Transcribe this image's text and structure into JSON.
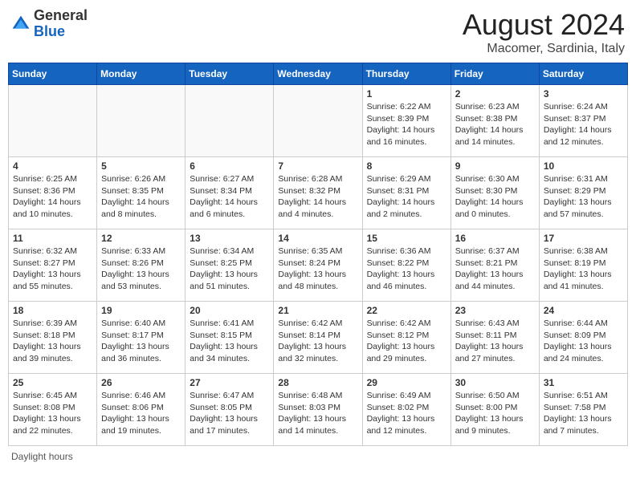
{
  "header": {
    "logo_general": "General",
    "logo_blue": "Blue",
    "title": "August 2024",
    "subtitle": "Macomer, Sardinia, Italy"
  },
  "days_of_week": [
    "Sunday",
    "Monday",
    "Tuesday",
    "Wednesday",
    "Thursday",
    "Friday",
    "Saturday"
  ],
  "footer": {
    "label": "Daylight hours"
  },
  "weeks": [
    [
      {
        "day": "",
        "sunrise": "",
        "sunset": "",
        "daylight": "",
        "empty": true
      },
      {
        "day": "",
        "sunrise": "",
        "sunset": "",
        "daylight": "",
        "empty": true
      },
      {
        "day": "",
        "sunrise": "",
        "sunset": "",
        "daylight": "",
        "empty": true
      },
      {
        "day": "",
        "sunrise": "",
        "sunset": "",
        "daylight": "",
        "empty": true
      },
      {
        "day": "1",
        "sunrise": "Sunrise: 6:22 AM",
        "sunset": "Sunset: 8:39 PM",
        "daylight": "Daylight: 14 hours and 16 minutes."
      },
      {
        "day": "2",
        "sunrise": "Sunrise: 6:23 AM",
        "sunset": "Sunset: 8:38 PM",
        "daylight": "Daylight: 14 hours and 14 minutes."
      },
      {
        "day": "3",
        "sunrise": "Sunrise: 6:24 AM",
        "sunset": "Sunset: 8:37 PM",
        "daylight": "Daylight: 14 hours and 12 minutes."
      }
    ],
    [
      {
        "day": "4",
        "sunrise": "Sunrise: 6:25 AM",
        "sunset": "Sunset: 8:36 PM",
        "daylight": "Daylight: 14 hours and 10 minutes."
      },
      {
        "day": "5",
        "sunrise": "Sunrise: 6:26 AM",
        "sunset": "Sunset: 8:35 PM",
        "daylight": "Daylight: 14 hours and 8 minutes."
      },
      {
        "day": "6",
        "sunrise": "Sunrise: 6:27 AM",
        "sunset": "Sunset: 8:34 PM",
        "daylight": "Daylight: 14 hours and 6 minutes."
      },
      {
        "day": "7",
        "sunrise": "Sunrise: 6:28 AM",
        "sunset": "Sunset: 8:32 PM",
        "daylight": "Daylight: 14 hours and 4 minutes."
      },
      {
        "day": "8",
        "sunrise": "Sunrise: 6:29 AM",
        "sunset": "Sunset: 8:31 PM",
        "daylight": "Daylight: 14 hours and 2 minutes."
      },
      {
        "day": "9",
        "sunrise": "Sunrise: 6:30 AM",
        "sunset": "Sunset: 8:30 PM",
        "daylight": "Daylight: 14 hours and 0 minutes."
      },
      {
        "day": "10",
        "sunrise": "Sunrise: 6:31 AM",
        "sunset": "Sunset: 8:29 PM",
        "daylight": "Daylight: 13 hours and 57 minutes."
      }
    ],
    [
      {
        "day": "11",
        "sunrise": "Sunrise: 6:32 AM",
        "sunset": "Sunset: 8:27 PM",
        "daylight": "Daylight: 13 hours and 55 minutes."
      },
      {
        "day": "12",
        "sunrise": "Sunrise: 6:33 AM",
        "sunset": "Sunset: 8:26 PM",
        "daylight": "Daylight: 13 hours and 53 minutes."
      },
      {
        "day": "13",
        "sunrise": "Sunrise: 6:34 AM",
        "sunset": "Sunset: 8:25 PM",
        "daylight": "Daylight: 13 hours and 51 minutes."
      },
      {
        "day": "14",
        "sunrise": "Sunrise: 6:35 AM",
        "sunset": "Sunset: 8:24 PM",
        "daylight": "Daylight: 13 hours and 48 minutes."
      },
      {
        "day": "15",
        "sunrise": "Sunrise: 6:36 AM",
        "sunset": "Sunset: 8:22 PM",
        "daylight": "Daylight: 13 hours and 46 minutes."
      },
      {
        "day": "16",
        "sunrise": "Sunrise: 6:37 AM",
        "sunset": "Sunset: 8:21 PM",
        "daylight": "Daylight: 13 hours and 44 minutes."
      },
      {
        "day": "17",
        "sunrise": "Sunrise: 6:38 AM",
        "sunset": "Sunset: 8:19 PM",
        "daylight": "Daylight: 13 hours and 41 minutes."
      }
    ],
    [
      {
        "day": "18",
        "sunrise": "Sunrise: 6:39 AM",
        "sunset": "Sunset: 8:18 PM",
        "daylight": "Daylight: 13 hours and 39 minutes."
      },
      {
        "day": "19",
        "sunrise": "Sunrise: 6:40 AM",
        "sunset": "Sunset: 8:17 PM",
        "daylight": "Daylight: 13 hours and 36 minutes."
      },
      {
        "day": "20",
        "sunrise": "Sunrise: 6:41 AM",
        "sunset": "Sunset: 8:15 PM",
        "daylight": "Daylight: 13 hours and 34 minutes."
      },
      {
        "day": "21",
        "sunrise": "Sunrise: 6:42 AM",
        "sunset": "Sunset: 8:14 PM",
        "daylight": "Daylight: 13 hours and 32 minutes."
      },
      {
        "day": "22",
        "sunrise": "Sunrise: 6:42 AM",
        "sunset": "Sunset: 8:12 PM",
        "daylight": "Daylight: 13 hours and 29 minutes."
      },
      {
        "day": "23",
        "sunrise": "Sunrise: 6:43 AM",
        "sunset": "Sunset: 8:11 PM",
        "daylight": "Daylight: 13 hours and 27 minutes."
      },
      {
        "day": "24",
        "sunrise": "Sunrise: 6:44 AM",
        "sunset": "Sunset: 8:09 PM",
        "daylight": "Daylight: 13 hours and 24 minutes."
      }
    ],
    [
      {
        "day": "25",
        "sunrise": "Sunrise: 6:45 AM",
        "sunset": "Sunset: 8:08 PM",
        "daylight": "Daylight: 13 hours and 22 minutes."
      },
      {
        "day": "26",
        "sunrise": "Sunrise: 6:46 AM",
        "sunset": "Sunset: 8:06 PM",
        "daylight": "Daylight: 13 hours and 19 minutes."
      },
      {
        "day": "27",
        "sunrise": "Sunrise: 6:47 AM",
        "sunset": "Sunset: 8:05 PM",
        "daylight": "Daylight: 13 hours and 17 minutes."
      },
      {
        "day": "28",
        "sunrise": "Sunrise: 6:48 AM",
        "sunset": "Sunset: 8:03 PM",
        "daylight": "Daylight: 13 hours and 14 minutes."
      },
      {
        "day": "29",
        "sunrise": "Sunrise: 6:49 AM",
        "sunset": "Sunset: 8:02 PM",
        "daylight": "Daylight: 13 hours and 12 minutes."
      },
      {
        "day": "30",
        "sunrise": "Sunrise: 6:50 AM",
        "sunset": "Sunset: 8:00 PM",
        "daylight": "Daylight: 13 hours and 9 minutes."
      },
      {
        "day": "31",
        "sunrise": "Sunrise: 6:51 AM",
        "sunset": "Sunset: 7:58 PM",
        "daylight": "Daylight: 13 hours and 7 minutes."
      }
    ]
  ]
}
